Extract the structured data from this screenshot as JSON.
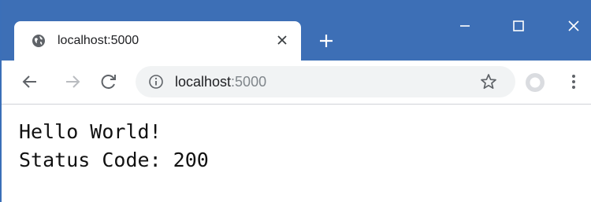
{
  "tab": {
    "title": "localhost:5000",
    "favicon": "globe-icon",
    "close_icon": "close-icon"
  },
  "window_controls": {
    "new_tab_icon": "plus-icon",
    "minimize_icon": "minimize-icon",
    "maximize_icon": "maximize-icon",
    "close_icon": "close-icon"
  },
  "toolbar": {
    "back_icon": "arrow-left-icon",
    "forward_icon": "arrow-right-icon",
    "reload_icon": "reload-icon",
    "site_info_icon": "info-icon",
    "url_host": "localhost",
    "url_port": ":5000",
    "bookmark_icon": "star-icon",
    "profile_icon": "profile-icon",
    "menu_icon": "more-vertical-icon"
  },
  "page": {
    "line1": "Hello World!",
    "line2": "Status Code: 200"
  },
  "colors": {
    "titlebar": "#3d6fb6",
    "omnibox": "#f1f3f4"
  }
}
